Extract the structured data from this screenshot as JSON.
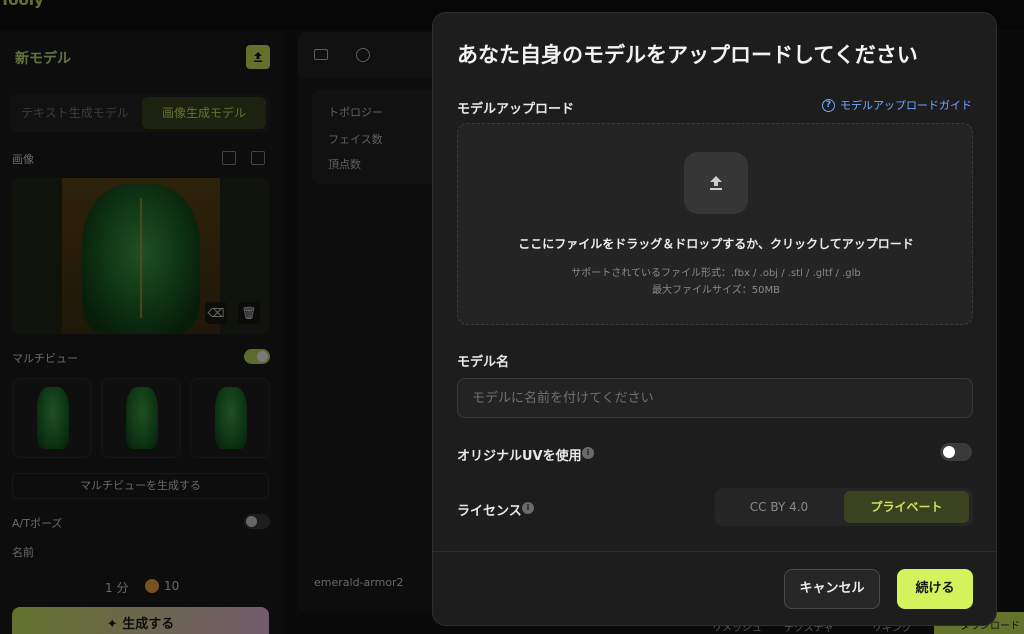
{
  "app": {
    "brand": "Tooly"
  },
  "sidebar": {
    "title": "新モデル",
    "tabs": [
      {
        "label": "テキスト生成モデル"
      },
      {
        "label": "画像生成モデル"
      }
    ],
    "image_label": "画像",
    "multiview_label": "マルチビュー",
    "generate_multiview": "マルチビューを生成する",
    "atpose_label": "A/Tポーズ",
    "name_label": "名前",
    "time": "1 分",
    "credits": "10",
    "generate_button": "生成する"
  },
  "viewer": {
    "info": {
      "topology": "トポロジー",
      "faces": "フェイス数",
      "vertices": "頂点数"
    },
    "model_name": "emerald-armor2",
    "bottom_tabs": [
      "リメッシュ",
      "テクスチャ",
      "リギング"
    ],
    "download": "ダウンロード"
  },
  "modal": {
    "title": "あなた自身のモデルをアップロードしてください",
    "upload_label": "モデルアップロード",
    "guide_link": "モデルアップロードガイド",
    "dropzone_main": "ここにファイルをドラッグ＆ドロップするか、クリックしてアップロード",
    "dropzone_formats": "サポートされているファイル形式：.fbx / .obj / .stl / .gltf / .glb",
    "dropzone_maxsize": "最大ファイルサイズ：50MB",
    "name_label": "モデル名",
    "name_placeholder": "モデルに名前を付けてください",
    "uv_label": "オリジナルUVを使用",
    "uv_enabled": false,
    "license_label": "ライセンス",
    "license_options": [
      "CC BY 4.0",
      "プライベート"
    ],
    "license_selected": "プライベート",
    "cancel_button": "キャンセル",
    "continue_button": "続ける"
  },
  "colors": {
    "accent": "#d4f25c",
    "link": "#6fa8ff",
    "modal_bg": "#1d1d1d"
  }
}
